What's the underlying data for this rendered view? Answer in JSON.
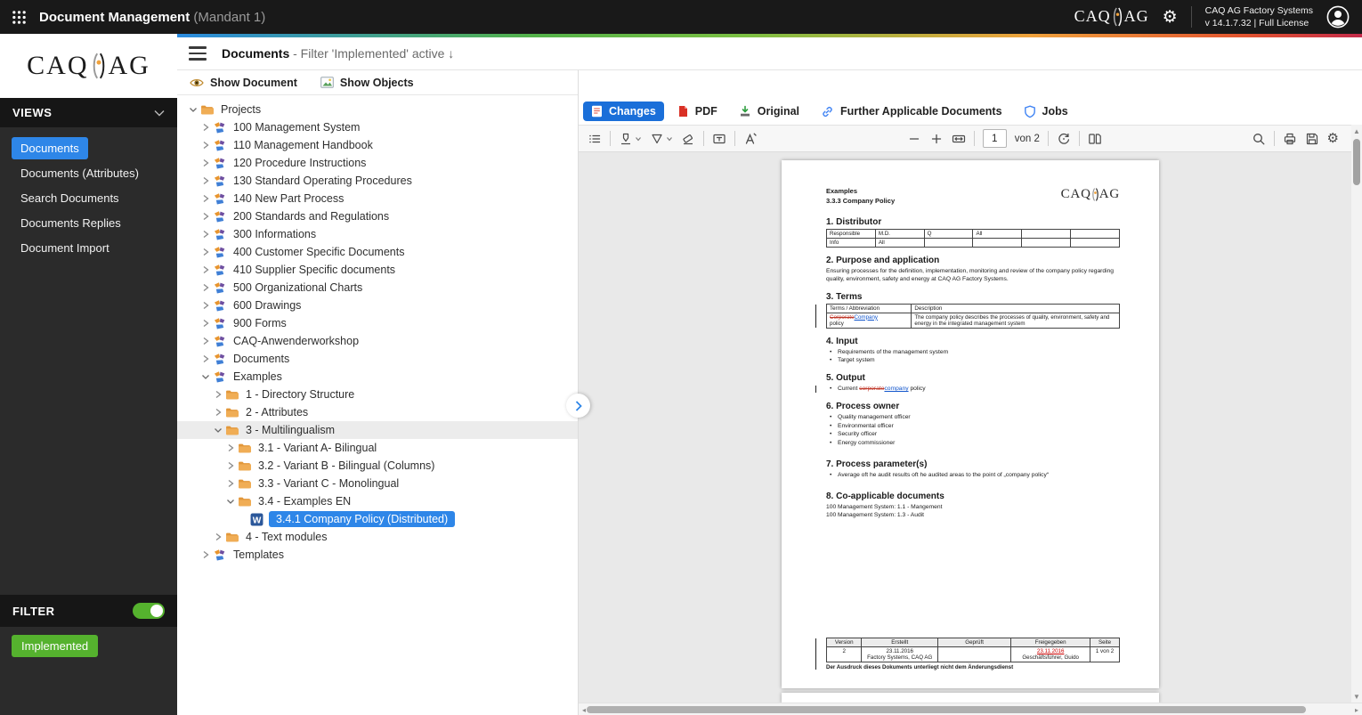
{
  "topbar": {
    "app_title": "Document Management",
    "client_label": "(Mandant 1)",
    "brand_left": "CAQ",
    "brand_right": "AG",
    "system_name": "CAQ AG Factory Systems",
    "version_info": "v 14.1.7.32  |  Full License"
  },
  "sidebar": {
    "views_header": "VIEWS",
    "items": [
      {
        "label": "Documents",
        "active": true
      },
      {
        "label": "Documents (Attributes)"
      },
      {
        "label": "Search Documents"
      },
      {
        "label": "Documents Replies"
      },
      {
        "label": "Document Import"
      }
    ],
    "filter_header": "FILTER",
    "filter_badge": "Implemented"
  },
  "tree_panel": {
    "title": "Documents",
    "subtitle": "- Filter 'Implemented' active ↓",
    "show_document_label": "Show Document",
    "show_objects_label": "Show Objects",
    "items": [
      {
        "label": "Projects",
        "depth": 0,
        "exp": "open",
        "icon": "folder"
      },
      {
        "label": "100 Management System",
        "depth": 1,
        "exp": "closed",
        "icon": "project"
      },
      {
        "label": "110 Management Handbook",
        "depth": 1,
        "exp": "closed",
        "icon": "project"
      },
      {
        "label": "120 Procedure Instructions",
        "depth": 1,
        "exp": "closed",
        "icon": "project"
      },
      {
        "label": "130 Standard Operating Procedures",
        "depth": 1,
        "exp": "closed",
        "icon": "project"
      },
      {
        "label": "140 New Part Process",
        "depth": 1,
        "exp": "closed",
        "icon": "project"
      },
      {
        "label": "200 Standards and Regulations",
        "depth": 1,
        "exp": "closed",
        "icon": "project"
      },
      {
        "label": "300 Informations",
        "depth": 1,
        "exp": "closed",
        "icon": "project"
      },
      {
        "label": "400 Customer Specific Documents",
        "depth": 1,
        "exp": "closed",
        "icon": "project"
      },
      {
        "label": "410 Supplier Specific documents",
        "depth": 1,
        "exp": "closed",
        "icon": "project"
      },
      {
        "label": "500 Organizational Charts",
        "depth": 1,
        "exp": "closed",
        "icon": "project"
      },
      {
        "label": "600 Drawings",
        "depth": 1,
        "exp": "closed",
        "icon": "project"
      },
      {
        "label": "900 Forms",
        "depth": 1,
        "exp": "closed",
        "icon": "project"
      },
      {
        "label": "CAQ-Anwenderworkshop",
        "depth": 1,
        "exp": "closed",
        "icon": "project"
      },
      {
        "label": "Documents",
        "depth": 1,
        "exp": "closed",
        "icon": "project"
      },
      {
        "label": "Examples",
        "depth": 1,
        "exp": "open",
        "icon": "project"
      },
      {
        "label": "1 - Directory Structure",
        "depth": 2,
        "exp": "closed",
        "icon": "folder"
      },
      {
        "label": "2 - Attributes",
        "depth": 2,
        "exp": "closed",
        "icon": "folder"
      },
      {
        "label": "3 - Multilingualism",
        "depth": 2,
        "exp": "open",
        "icon": "folder",
        "hl": true
      },
      {
        "label": "3.1 - Variant A- Bilingual",
        "depth": 3,
        "exp": "closed",
        "icon": "folder"
      },
      {
        "label": "3.2 - Variant B - Bilingual (Columns)",
        "depth": 3,
        "exp": "closed",
        "icon": "folder"
      },
      {
        "label": "3.3 - Variant C - Monolingual",
        "depth": 3,
        "exp": "closed",
        "icon": "folder"
      },
      {
        "label": "3.4 - Examples EN",
        "depth": 3,
        "exp": "open",
        "icon": "folder"
      },
      {
        "label": "3.4.1 Company Policy (Distributed)",
        "depth": 4,
        "exp": "none",
        "icon": "word",
        "sel": true
      },
      {
        "label": "4 - Text modules",
        "depth": 2,
        "exp": "closed",
        "icon": "folder"
      },
      {
        "label": "Templates",
        "depth": 1,
        "exp": "closed",
        "icon": "project"
      }
    ]
  },
  "viewer": {
    "tabs": [
      {
        "label": "Changes",
        "active": true
      },
      {
        "label": "PDF"
      },
      {
        "label": "Original"
      },
      {
        "label": "Further Applicable Documents"
      },
      {
        "label": "Jobs"
      }
    ],
    "toolbar": {
      "page_value": "1",
      "page_count": "von 2"
    }
  },
  "doc": {
    "header_line1": "Examples",
    "header_line2": "3.3.3 Company Policy",
    "logo_left": "CAQ",
    "logo_right": "AG",
    "s1_title": "1. Distributor",
    "dist_rows": [
      [
        "Responsible",
        "M.D.",
        "Q",
        "All",
        "",
        ""
      ],
      [
        "Info",
        "All",
        "",
        "",
        "",
        ""
      ]
    ],
    "s2_title": "2. Purpose and application",
    "s2_text": "Ensuring processes for the definition, implementation, monitoring and review of the company policy regarding quality, environment, safety and energy at CAQ AG Factory Systems.",
    "s3_title": "3. Terms",
    "terms_col1": "Terms / Abbreviation",
    "terms_col2": "Description",
    "terms_deleted": "Corporate",
    "terms_inserted": "Company",
    "terms_tail": "policy",
    "terms_description": "The company policy describes the processes of quality, environment, safety and energy in the integrated management system",
    "s4_title": "4. Input",
    "s4_bullets": [
      "Requirements of the management system",
      "Target system"
    ],
    "s5_title": "5. Output",
    "s5_pre": "Current",
    "s5_deleted": "corporate",
    "s5_inserted": "company",
    "s5_tail": "policy",
    "s6_title": "6. Process owner",
    "s6_bullets": [
      "Quality management officer",
      "Environmental officer",
      "Security officer",
      "Energy commissioner"
    ],
    "s7_title": "7. Process parameter(s)",
    "s7_bullets": [
      "Average oft he audit results oft he audited areas to the point of „company policy“"
    ],
    "s8_title": "8. Co-applicable documents",
    "s8_lines": [
      "100 Management System: 1.1 - Mangement",
      "100 Management System: 1.3 - Audit"
    ],
    "footer_headers": [
      "Version",
      "Erstellt",
      "Geprüft",
      "Freigegeben",
      "Seite"
    ],
    "footer_version": "2",
    "footer_created_date": "23.11.2016",
    "footer_created_by": "Factory Systems, CAQ AG",
    "footer_checked": "",
    "footer_released_date": "23.11.2016",
    "footer_released_by": "Geschäftsführer, Guido",
    "footer_page": "1 von 2",
    "footer_note": "Der Ausdruck dieses Dokuments unterliegt nicht dem Änderungsdienst"
  }
}
